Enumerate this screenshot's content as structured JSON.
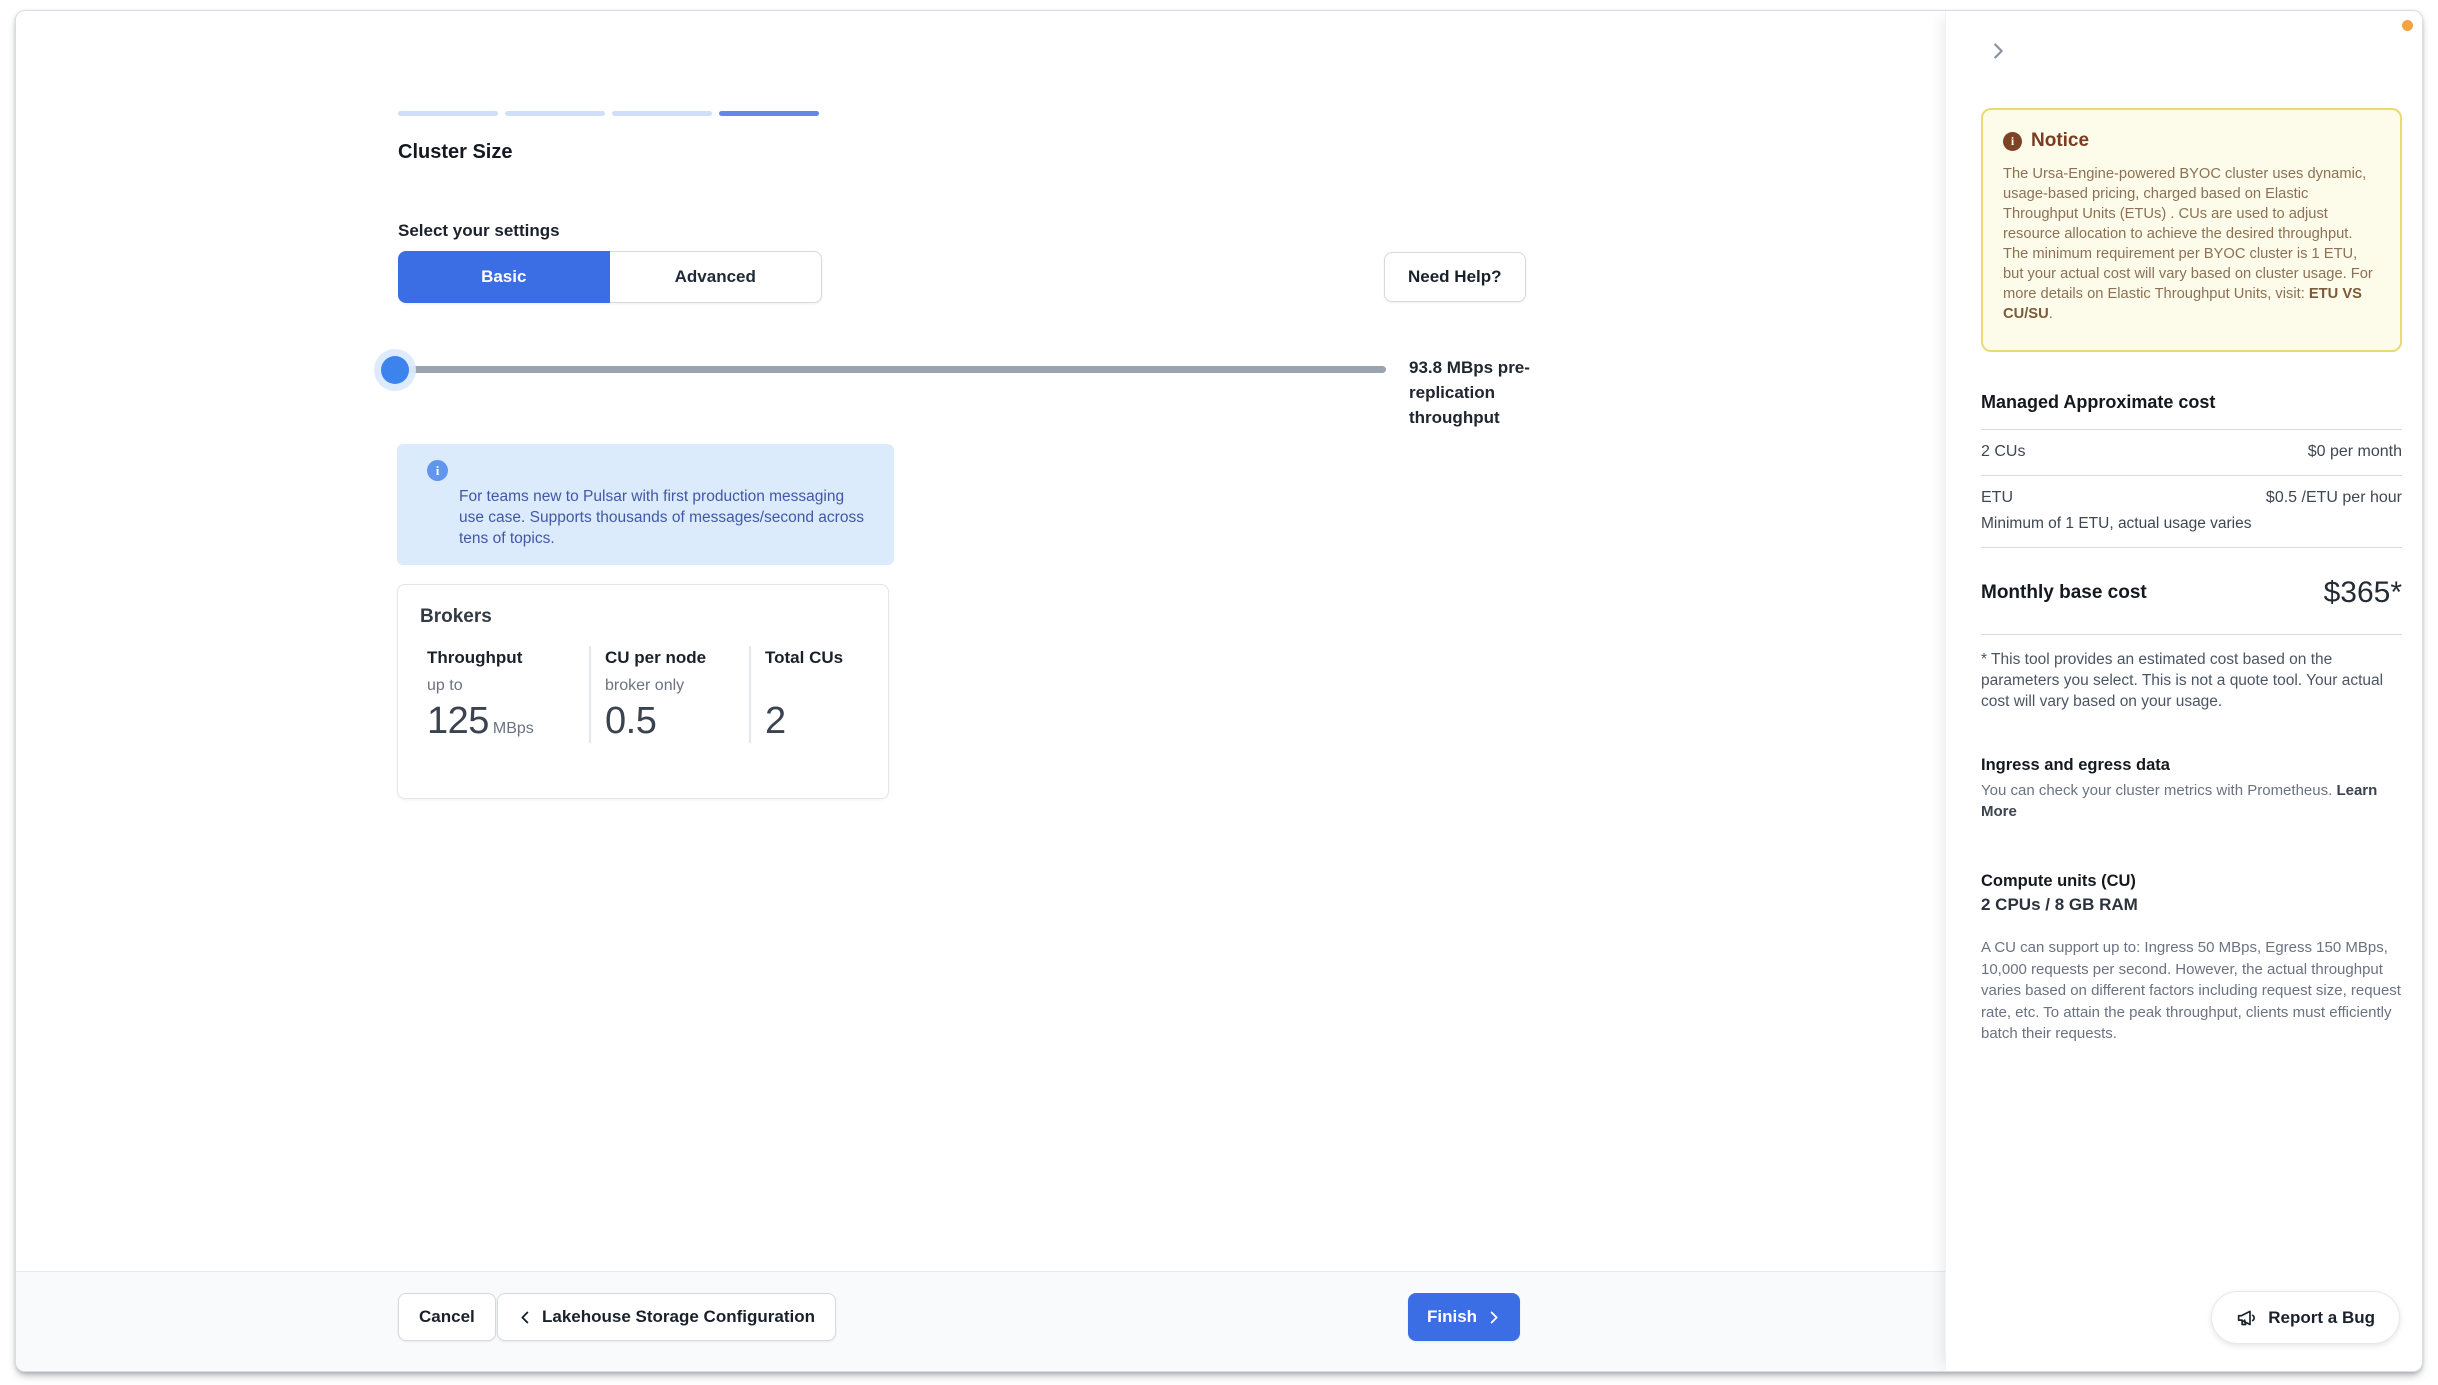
{
  "page": {
    "title": "Cluster Size",
    "steps": {
      "total": 4,
      "current": 4
    },
    "settings_label": "Select your settings",
    "modes": {
      "basic": "Basic",
      "advanced": "Advanced"
    },
    "need_help_label": "Need Help?",
    "slider": {
      "caption": "93.8 MBps pre-replication throughput",
      "position": "min"
    },
    "info_banner": "For teams new to Pulsar with first production messaging use case. Supports thousands of messages/second across tens of topics."
  },
  "brokers": {
    "title": "Brokers",
    "columns": [
      {
        "header": "Throughput",
        "note": "up to",
        "value": "125",
        "unit": "MBps"
      },
      {
        "header": "CU per node",
        "note": "broker only",
        "value": "0.5",
        "unit": ""
      },
      {
        "header": "Total CUs",
        "note": "",
        "value": "2",
        "unit": ""
      }
    ]
  },
  "footer": {
    "cancel_label": "Cancel",
    "back_label": "Lakehouse Storage Configuration",
    "finish_label": "Finish"
  },
  "sidebar": {
    "notice": {
      "title": "Notice",
      "body": "The Ursa-Engine-powered BYOC cluster uses dynamic, usage-based pricing, charged based on Elastic Throughput Units (ETUs) . CUs are used to adjust resource allocation to achieve the desired throughput. The minimum requirement per BYOC cluster is 1 ETU, but your actual cost will vary based on cluster usage. For more details on Elastic Throughput Units, visit: ",
      "link_label": "ETU VS CU/SU",
      "suffix": "."
    },
    "cost": {
      "title": "Managed Approximate cost",
      "rows": [
        {
          "label": "2 CUs",
          "value": "$0 per month"
        },
        {
          "label": "ETU",
          "value": "$0.5 /ETU per hour",
          "sub": "Minimum of 1 ETU, actual usage varies"
        }
      ],
      "monthly_label": "Monthly base cost",
      "monthly_value": "$365*",
      "disclaimer": "* This tool provides an estimated cost based on the parameters you select. This is not a quote tool. Your actual cost will vary based on your usage."
    },
    "metrics_note": {
      "title": "Ingress and egress data",
      "body": "You can check your cluster metrics with Prometheus. ",
      "link_label": "Learn More"
    },
    "compute_units": {
      "title": "Compute units (CU)",
      "subtitle": "2 CPUs / 8 GB RAM",
      "body": "A CU can support up to: Ingress 50 MBps, Egress 150 MBps, 10,000 requests per second. However, the actual throughput varies based on different factors including request size, request rate, etc. To attain the peak throughput, clients must efficiently batch their requests."
    },
    "report_bug_label": "Report a Bug"
  },
  "colors": {
    "primary_blue": "#3b6de4",
    "slider_handle_blue": "#3d83ee",
    "progress_active": "#6187e8",
    "progress_inactive": "#cfdff9",
    "info_banner_bg": "#dcebfb",
    "notice_bg": "#fdfbe9",
    "notice_border": "#e9da74",
    "notification_orange": "#f5a243"
  }
}
